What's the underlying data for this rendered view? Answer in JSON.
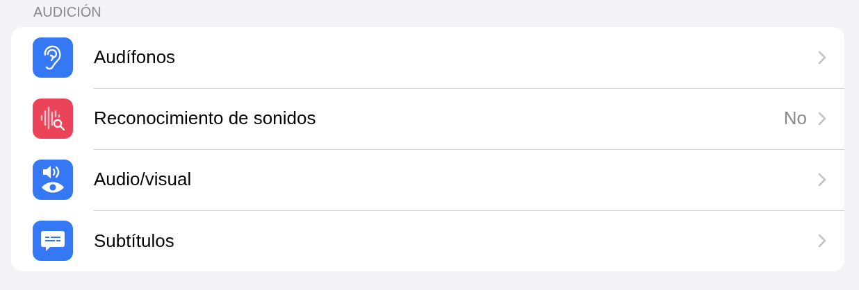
{
  "section": {
    "title": "AUDICIÓN"
  },
  "rows": [
    {
      "kind": "ear",
      "color": "#3478f6",
      "label": "Audífonos"
    },
    {
      "kind": "sound-search",
      "color": "#eb445a",
      "label": "Reconocimiento de sonidos",
      "value": "No"
    },
    {
      "kind": "speaker-eye",
      "color": "#3478f6",
      "label": "Audio/visual"
    },
    {
      "kind": "caption",
      "color": "#3478f6",
      "label": "Subtítulos"
    }
  ]
}
